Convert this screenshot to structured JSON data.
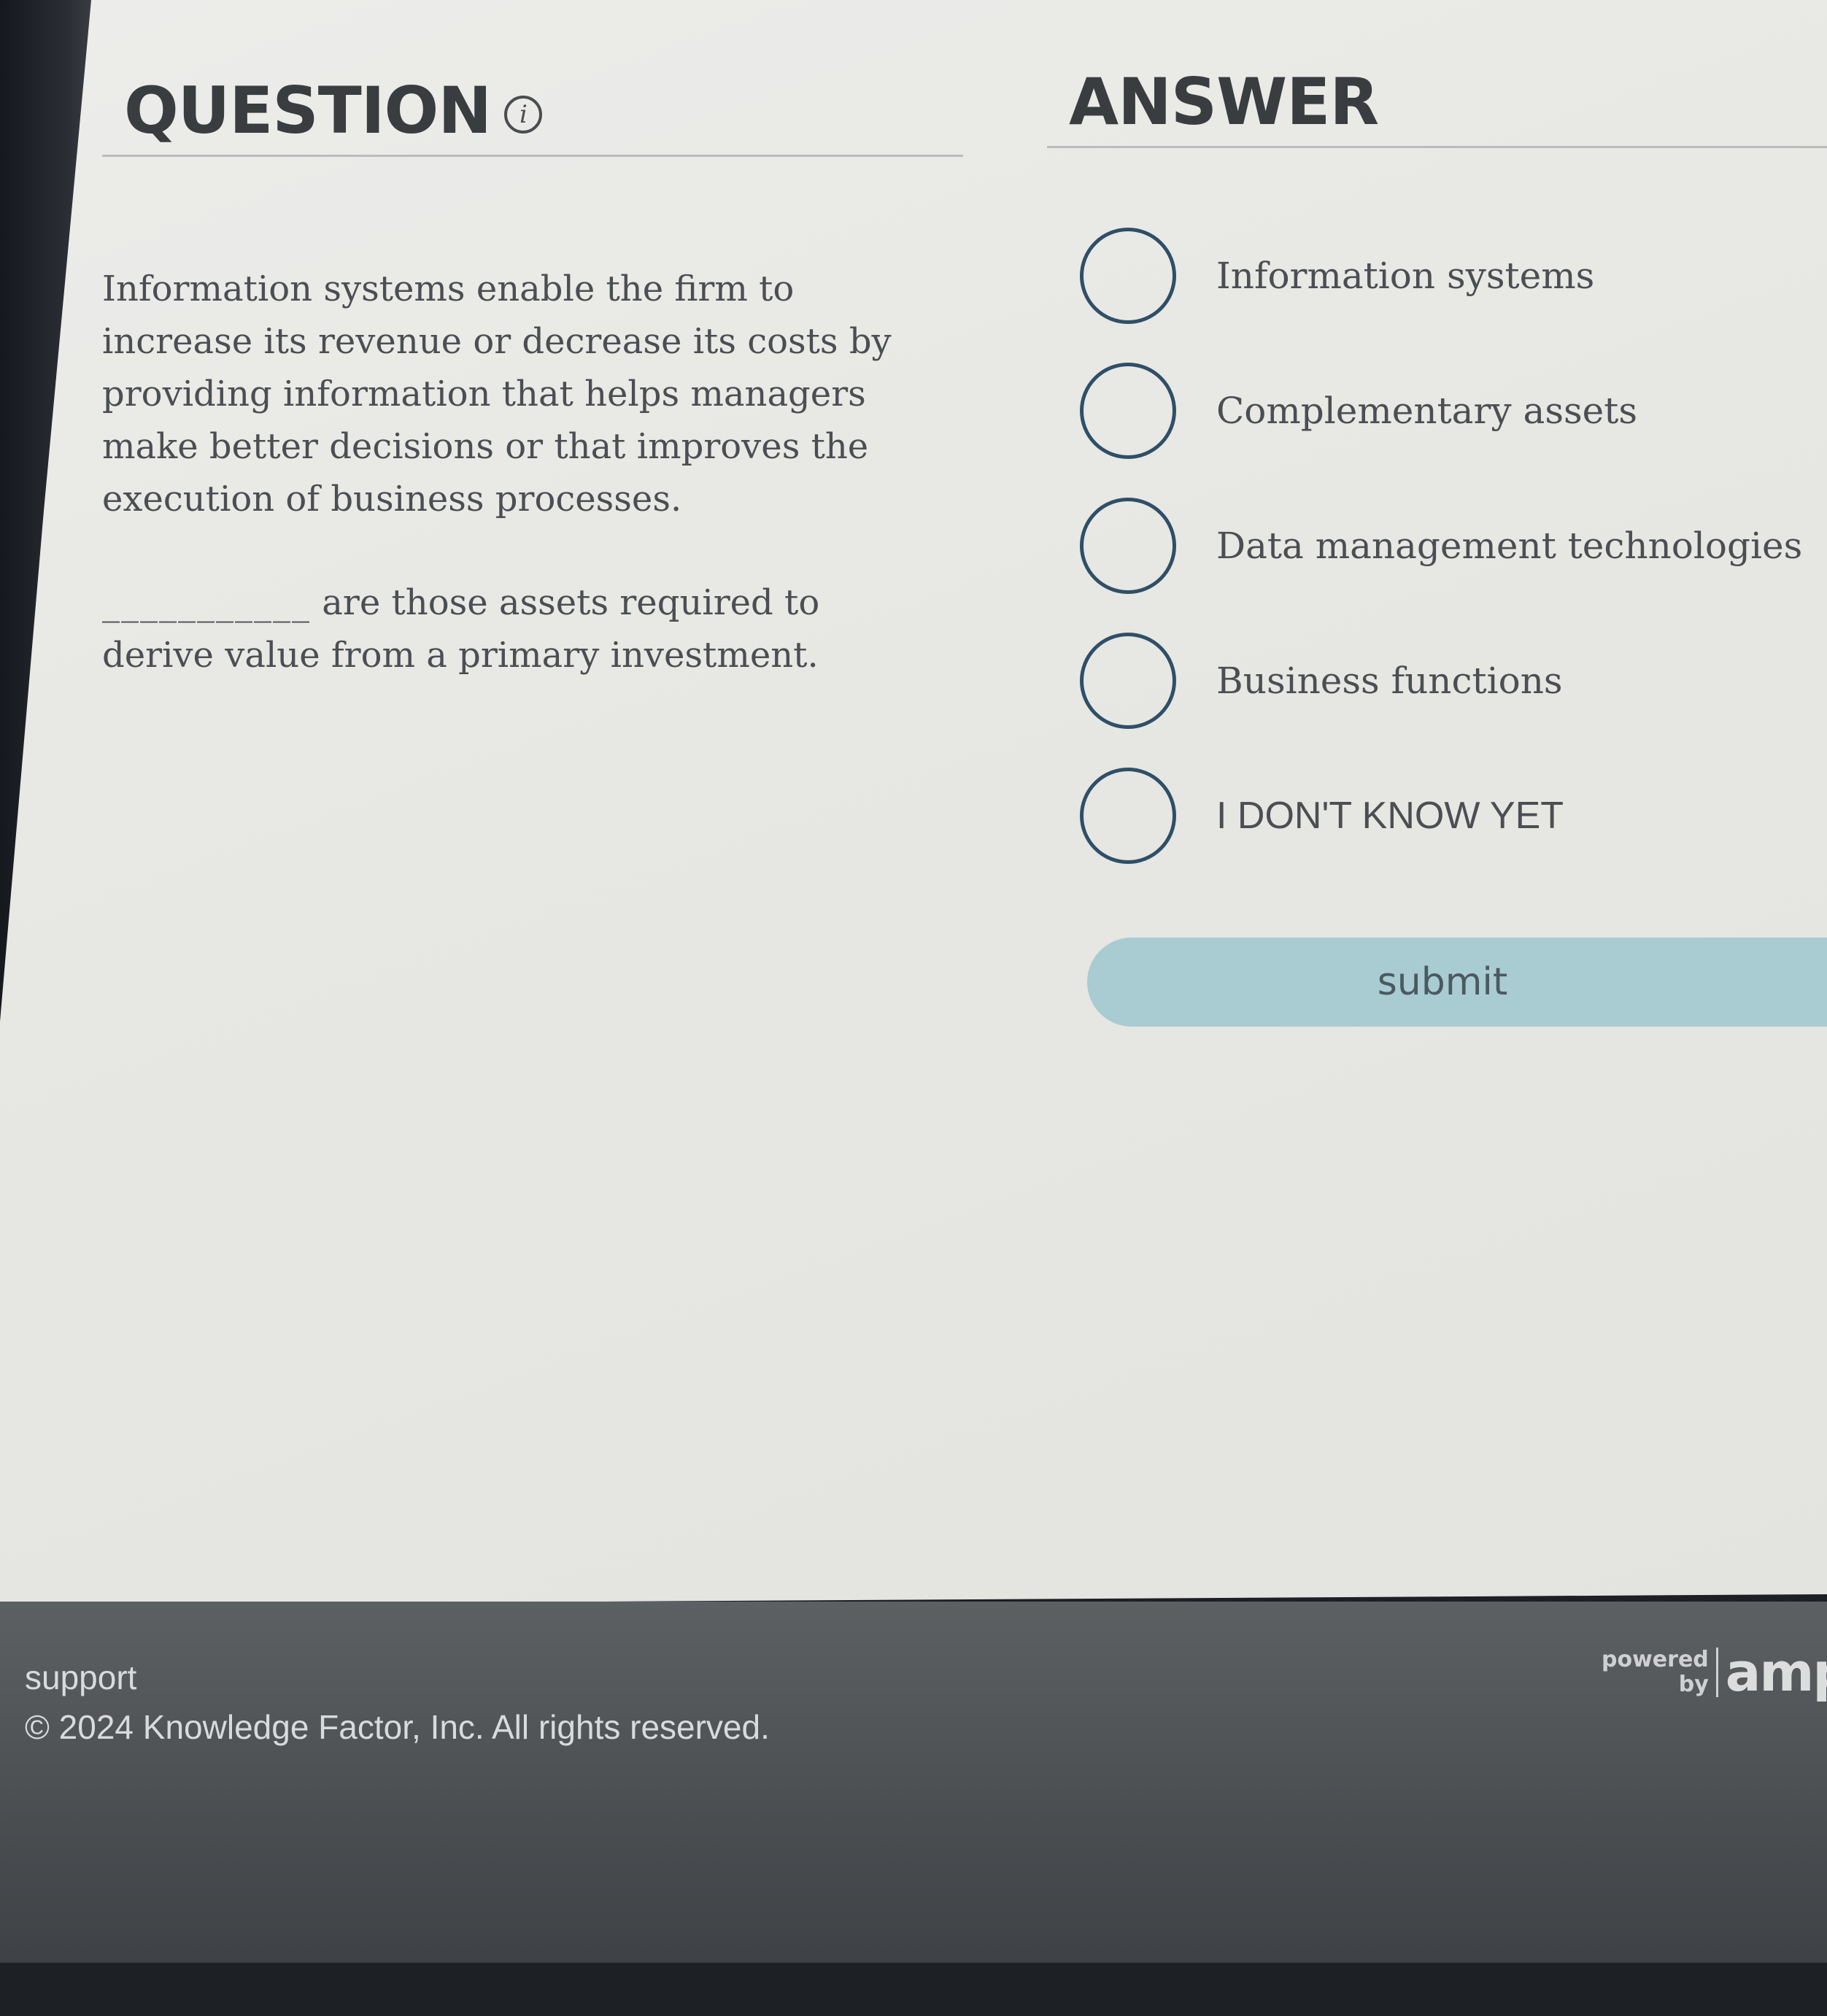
{
  "question": {
    "title": "QUESTION",
    "paragraphs": [
      "Information systems enable the firm to increase its revenue or decrease its costs by providing information that helps managers make better decisions or that improves the execution of business processes.",
      "are those assets required to derive value from a primary investment."
    ],
    "blank": "___________"
  },
  "answer": {
    "title": "ANSWER",
    "options": [
      "Information systems",
      "Complementary assets",
      "Data management technologies",
      "Business functions",
      "I DON'T KNOW YET"
    ],
    "submit_label": "submit"
  },
  "footer": {
    "support_label": "support",
    "copyright": "© 2024 Knowledge Factor, Inc. All rights reserved.",
    "powered_line1": "powered",
    "powered_line2": "by",
    "logo_text": "amp"
  },
  "icons": {
    "info": "info-icon",
    "radio": "radio-unselected"
  }
}
